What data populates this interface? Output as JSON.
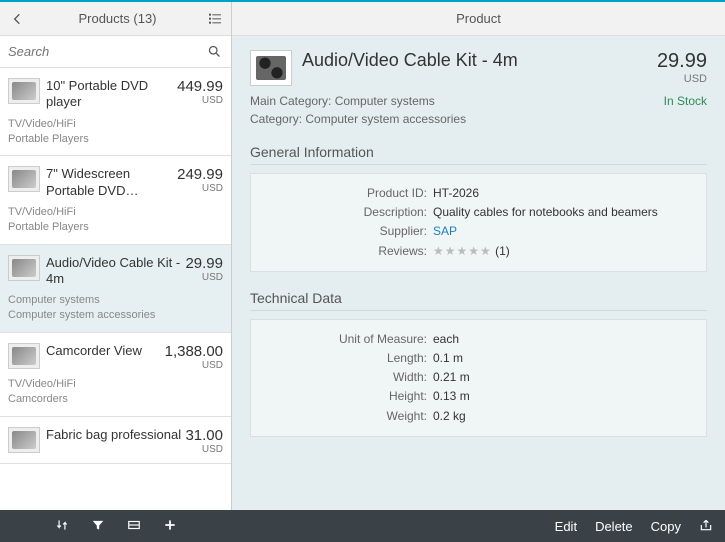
{
  "master": {
    "title": "Products (13)",
    "search_placeholder": "Search",
    "items": [
      {
        "name": "10\" Portable DVD player",
        "price": "449.99",
        "currency": "USD",
        "cat1": "TV/Video/HiFi",
        "cat2": "Portable Players"
      },
      {
        "name": "7\" Widescreen Portable DVD…",
        "price": "249.99",
        "currency": "USD",
        "cat1": "TV/Video/HiFi",
        "cat2": "Portable Players"
      },
      {
        "name": "Audio/Video Cable Kit - 4m",
        "price": "29.99",
        "currency": "USD",
        "cat1": "Computer systems",
        "cat2": "Computer system accessories",
        "selected": true
      },
      {
        "name": "Camcorder View",
        "price": "1,388.00",
        "currency": "USD",
        "cat1": "TV/Video/HiFi",
        "cat2": "Camcorders"
      },
      {
        "name": "Fabric bag professional",
        "price": "31.00",
        "currency": "USD",
        "cat1": "",
        "cat2": ""
      }
    ]
  },
  "detail": {
    "header": "Product",
    "title": "Audio/Video Cable Kit - 4m",
    "price": "29.99",
    "currency": "USD",
    "main_category_label": "Main Category:",
    "main_category": "Computer systems",
    "stock": "In Stock",
    "category_label": "Category:",
    "category": "Computer system accessories",
    "sections": {
      "general": {
        "title": "General Information",
        "product_id_label": "Product ID:",
        "product_id": "HT-2026",
        "description_label": "Description:",
        "description": "Quality cables for notebooks and beamers",
        "supplier_label": "Supplier:",
        "supplier": "SAP",
        "reviews_label": "Reviews:",
        "reviews_stars": "★★★★★",
        "reviews_count": "(1)"
      },
      "technical": {
        "title": "Technical Data",
        "uom_label": "Unit of Measure:",
        "uom": "each",
        "length_label": "Length:",
        "length": "0.1 m",
        "width_label": "Width:",
        "width": "0.21 m",
        "height_label": "Height:",
        "height": "0.13 m",
        "weight_label": "Weight:",
        "weight": "0.2 kg"
      }
    }
  },
  "footer": {
    "edit": "Edit",
    "delete": "Delete",
    "copy": "Copy"
  }
}
